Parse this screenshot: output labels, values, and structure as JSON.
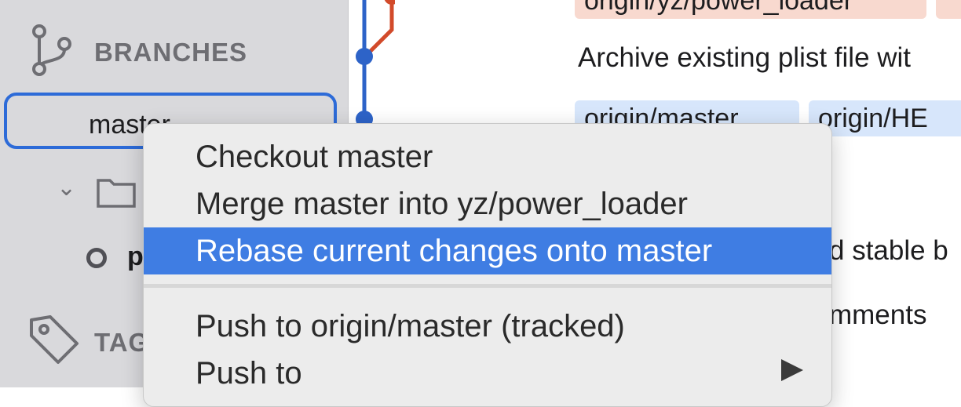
{
  "sidebar": {
    "branches_label": "BRANCHES",
    "selected_branch": "master",
    "child_item": "p",
    "tags_label": "TAG"
  },
  "main": {
    "badge_orange": "origin/yz/power_loader",
    "commit_message": "Archive existing plist file wit",
    "badge_blue_1": "origin/master",
    "badge_blue_2": "origin/HE",
    "partial_text_1": "d stable b",
    "partial_text_2": "mments"
  },
  "context_menu": {
    "items": [
      {
        "label": "Checkout master"
      },
      {
        "label": "Merge master into yz/power_loader"
      },
      {
        "label": "Rebase current changes onto master"
      },
      {
        "label": "Push to origin/master (tracked)"
      },
      {
        "label": "Push to"
      }
    ]
  },
  "colors": {
    "accent": "#3f7de3",
    "graph_blue": "#2d63c8",
    "graph_orange": "#d24a2a",
    "badge_orange_bg": "#f8d9cf",
    "badge_blue_bg": "#d7e6fb"
  },
  "icons": [
    "branch-icon",
    "folder-icon",
    "tag-icon",
    "chevron-down-icon",
    "submenu-arrow-icon"
  ]
}
